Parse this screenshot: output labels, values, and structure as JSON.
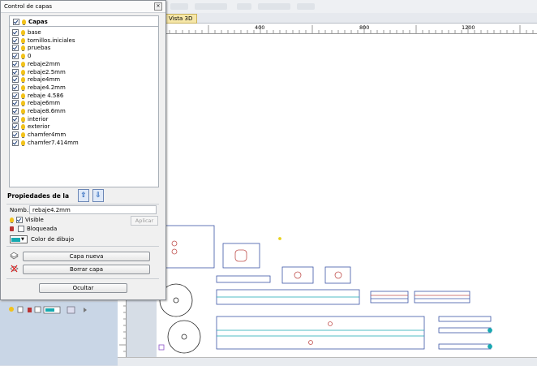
{
  "tab3d": {
    "label": "Vista 3D"
  },
  "ruler": {
    "ticks": [
      "400",
      "800",
      "1200"
    ]
  },
  "dialog": {
    "title": "Control de capas",
    "close_glyph": "×",
    "layers_header": "Capas",
    "layers": [
      "base",
      "tornillos.iniciales",
      "pruebas",
      "0",
      "rebaje2mm",
      "rebaje2.5mm",
      "rebaje4mm",
      "rebaje4.2mm",
      "rebaje 4.586",
      "rebaje6mm",
      "rebaje8.6mm",
      "interior",
      "exterior",
      "chamfer4mm",
      "chamfer7.414mm"
    ],
    "props_title": "Propiedades de la",
    "name_label": "Nomb.:",
    "name_value": "rebaje4.2mm",
    "visible_label": "Visible",
    "apply_label": "Aplicar",
    "locked_label": "Bloqueada",
    "color_label": "Color de dibujo",
    "new_layer_label": "Capa nueva",
    "delete_layer_label": "Borrar capa",
    "hide_label": "Ocultar"
  },
  "colors": {
    "layer_color": "#17a9b0",
    "accent": "#1f5fb8"
  }
}
